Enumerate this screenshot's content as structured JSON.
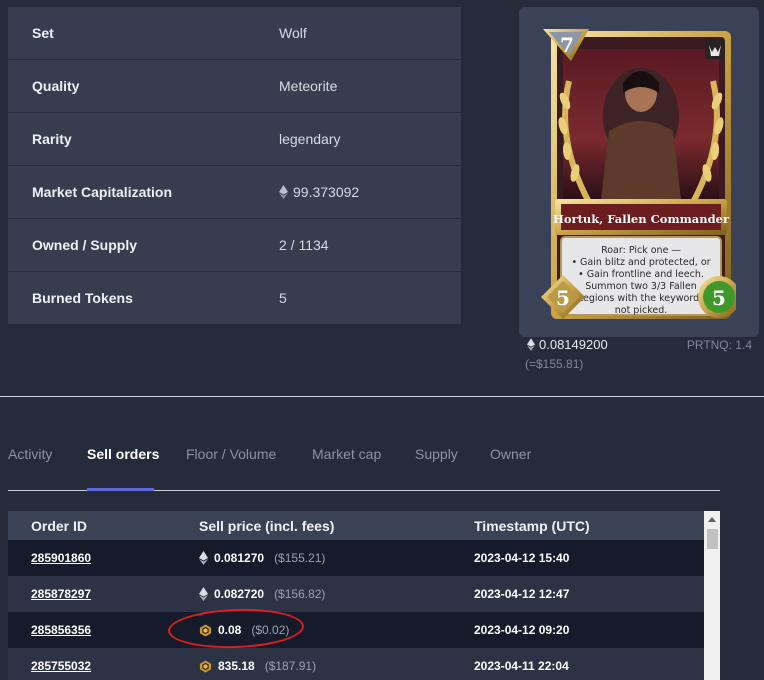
{
  "attributes": [
    {
      "label": "Set",
      "value": "Wolf"
    },
    {
      "label": "Quality",
      "value": "Meteorite"
    },
    {
      "label": "Rarity",
      "value": "legendary"
    },
    {
      "label": "Market Capitalization",
      "value": "99.373092",
      "icon": "eth-icon"
    },
    {
      "label": "Owned / Supply",
      "value": "2 / 1134"
    },
    {
      "label": "Burned Tokens",
      "value": "5"
    }
  ],
  "card": {
    "mana": "7",
    "name": "Hortuk, Fallen Commander",
    "text": "Roar: Pick one — • Gain blitz and protected, or • Gain frontline and leech. Summon two 3/3 Fallen Legions with the keywords not picked.",
    "attack": "5",
    "health": "5",
    "god_icon": "wolf-icon"
  },
  "price": {
    "eth": "0.08149200",
    "usd": "(=$155.81)",
    "rank": "PRTNQ: 1.4"
  },
  "tabs": [
    {
      "label": "Activity",
      "active": false
    },
    {
      "label": "Sell orders",
      "active": true
    },
    {
      "label": "Floor / Volume",
      "active": false
    },
    {
      "label": "Market cap",
      "active": false
    },
    {
      "label": "Supply",
      "active": false
    },
    {
      "label": "Owner",
      "active": false
    }
  ],
  "orders": {
    "headers": [
      "Order ID",
      "Sell price (incl. fees)",
      "Timestamp (UTC)"
    ],
    "rows": [
      {
        "id": "285901860",
        "price": "0.081270",
        "fiat": "($155.21)",
        "currency": "eth-icon",
        "timestamp": "2023-04-12 15:40"
      },
      {
        "id": "285878297",
        "price": "0.082720",
        "fiat": "($156.82)",
        "currency": "eth-icon",
        "timestamp": "2023-04-12 12:47"
      },
      {
        "id": "285856356",
        "price": "0.08",
        "fiat": "($0.02)",
        "currency": "gods-token-icon",
        "timestamp": "2023-04-12 09:20"
      },
      {
        "id": "285755032",
        "price": "835.18",
        "fiat": "($187.91)",
        "currency": "gods-token-icon",
        "timestamp": "2023-04-11 22:04"
      }
    ]
  },
  "colors": {
    "background": "#252b3b",
    "panel": "#353d4f",
    "accent": "#5a6bd8",
    "highlight_circle": "#e01d1d",
    "gods_token": "#c99a2e"
  }
}
